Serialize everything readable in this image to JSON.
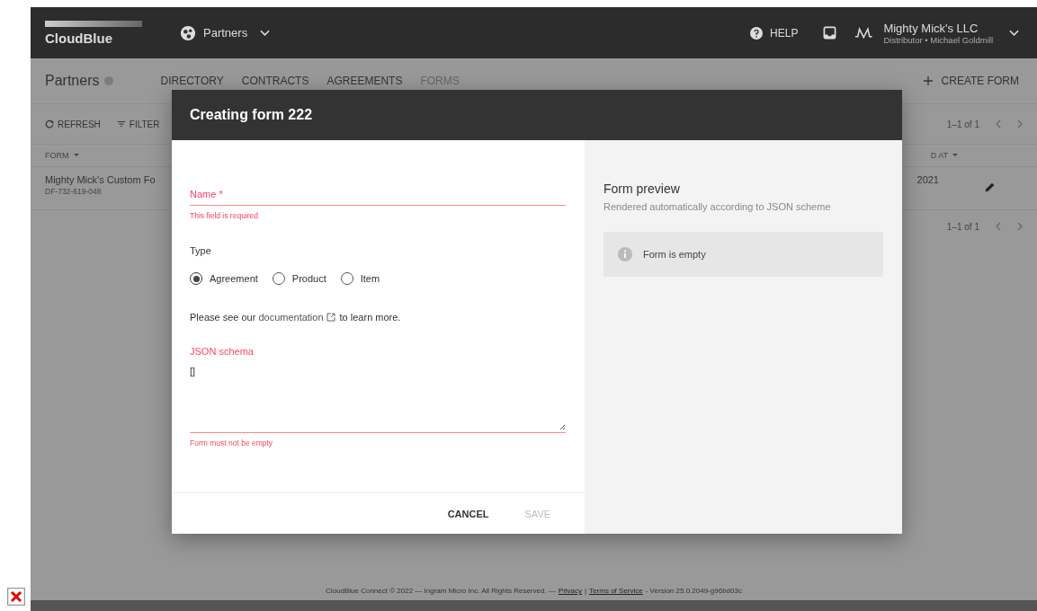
{
  "topbar": {
    "logo": "CloudBlue",
    "module": "Partners",
    "help": "HELP",
    "account_name": "Mighty Mick's LLC",
    "account_subtitle": "Distributor • Michael Goldmill"
  },
  "page": {
    "title": "Partners",
    "tabs": [
      {
        "label": "DIRECTORY",
        "selected": false
      },
      {
        "label": "CONTRACTS",
        "selected": false
      },
      {
        "label": "AGREEMENTS",
        "selected": false
      },
      {
        "label": "FORMS",
        "selected": true
      }
    ],
    "create_button": "CREATE FORM"
  },
  "toolbar": {
    "refresh": "REFRESH",
    "filter": "FILTER",
    "pager": "1–1 of 1"
  },
  "table": {
    "columns": [
      "FORM",
      "D AT"
    ],
    "rows": [
      {
        "name": "Mighty Mick's Custom Fo",
        "id": "DF-732-619-048",
        "date": "2021"
      }
    ]
  },
  "pager_bottom": "1–1 of 1",
  "dialog": {
    "title": "Creating form 222",
    "name_field": {
      "label": "Name",
      "required_mark": "*",
      "error": "This field is required"
    },
    "type_label": "Type",
    "type_options": [
      {
        "label": "Agreement",
        "selected": true
      },
      {
        "label": "Product",
        "selected": false
      },
      {
        "label": "Item",
        "selected": false
      }
    ],
    "help_before": "Please see our",
    "help_link": "documentation",
    "help_after": "to learn more.",
    "json_field": {
      "label": "JSON schema",
      "value": "[]",
      "error": "Form must not be empty"
    },
    "cancel": "CANCEL",
    "save": {
      "label": "SAVE",
      "disabled": true
    },
    "preview": {
      "title": "Form preview",
      "subtitle": "Rendered automatically according to JSON scheme",
      "empty": "Form is empty"
    }
  },
  "footer": {
    "text": "CloudBlue Connect © 2022 — Ingram Micro Inc. All Rights Reserved. —",
    "privacy": "Privacy",
    "separator": "|",
    "terms": "Terms of Service",
    "version": "- Version 25.0.2049-g96bd03c"
  }
}
